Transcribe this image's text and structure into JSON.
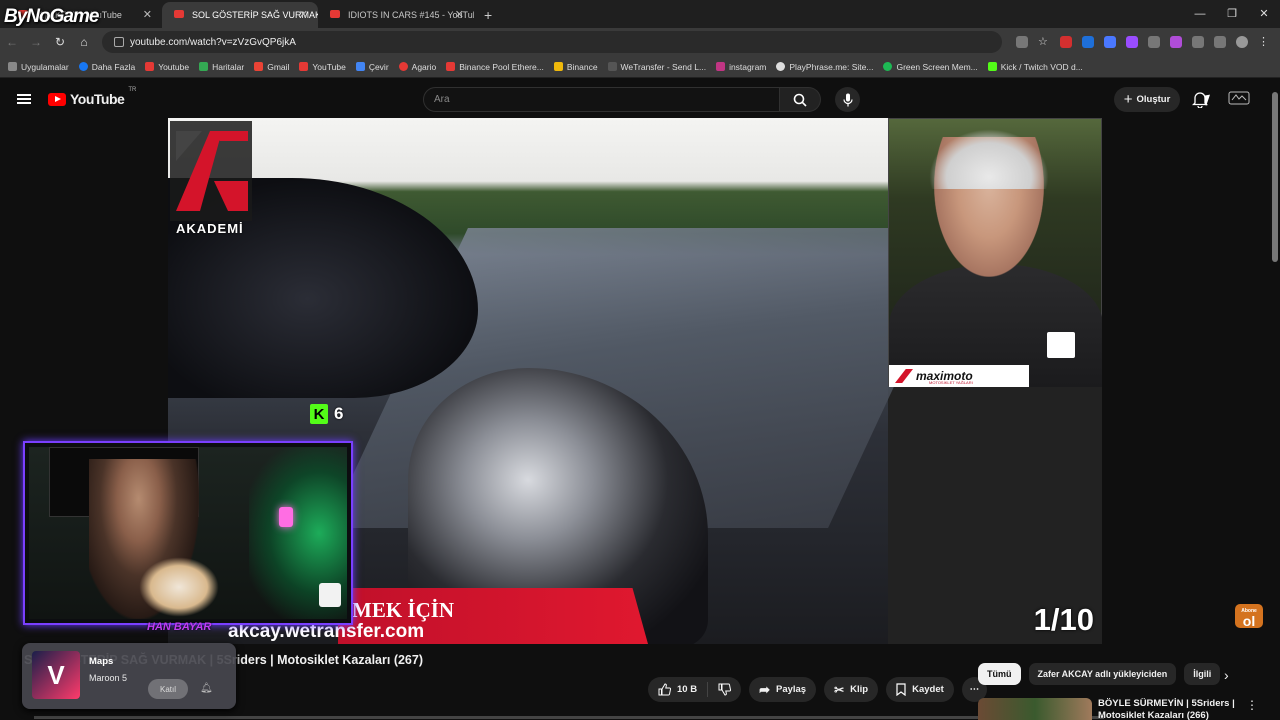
{
  "browser": {
    "overlay_logo": "ByNoGame",
    "tabs": [
      {
        "title": "(1) AKCAY - YouTube",
        "active": false
      },
      {
        "title": "SOL GÖSTERİP SAĞ VURMAK |",
        "active": true
      },
      {
        "title": "IDIOTS IN CARS #145 - YouTub",
        "active": false
      }
    ],
    "new_tab": "+",
    "url": "youtube.com/watch?v=zVzGvQP6jkA",
    "bookmarks": [
      "Uygulamalar",
      "Daha Fazla",
      "Youtube",
      "Haritalar",
      "Gmail",
      "YouTube",
      "Çevir",
      "Agario",
      "Binance Pool Ethere...",
      "Binance",
      "WeTransfer - Send L...",
      "instagram",
      "PlayPhrase.me: Site...",
      "Green Screen Mem...",
      "Kick / Twitch VOD d..."
    ]
  },
  "youtube": {
    "logo_text": "YouTube",
    "logo_region": "TR",
    "search_placeholder": "Ara",
    "create_label": "Oluştur"
  },
  "video": {
    "channel_overlay": "AKADEMİ",
    "kick_count": "6",
    "banner_line1": "MEK İÇİN",
    "banner_line2": "akcay.wetransfer.com",
    "pip_brand": "maximoto",
    "pip_brand_sub": "MOTOSİKLET YAĞLARI",
    "counter": "1/10",
    "abone_top": "Abone",
    "abone_bottom": "ol",
    "title": "SOL GÖSTERİP SAĞ VURMAK | 5Sriders | Motosiklet Kazaları (267)",
    "progress_fraction": 0.0
  },
  "actions": {
    "likes": "10 B",
    "share": "Paylaş",
    "clip": "Klip",
    "save": "Kaydet",
    "more": "⋯"
  },
  "chips": [
    "Tümü",
    "Zafer AKCAY adlı yükleyiciden",
    "İlgili"
  ],
  "recommendation": {
    "title": "BÖYLE SÜRMEYİN | 5Sriders | Motosiklet Kazaları (266)"
  },
  "media_popup": {
    "track": "Maps",
    "artist": "Maroon 5",
    "join": "Katıl"
  },
  "webcam": {
    "signature": "HAN BAYAR"
  }
}
